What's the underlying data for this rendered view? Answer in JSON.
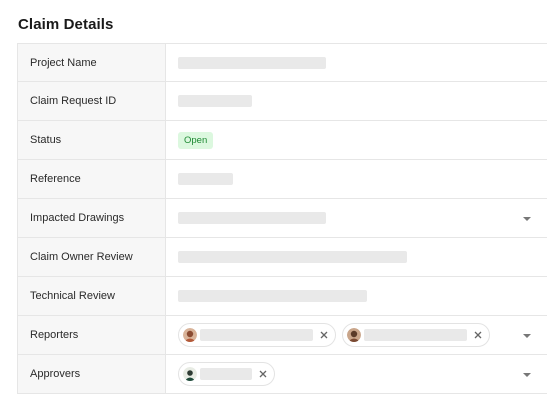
{
  "panel": {
    "title": "Claim Details"
  },
  "rows": [
    {
      "label": "Project Name"
    },
    {
      "label": "Claim Request ID"
    },
    {
      "label": "Status",
      "status": "Open"
    },
    {
      "label": "Reference"
    },
    {
      "label": "Impacted Drawings"
    },
    {
      "label": "Claim Owner Review"
    },
    {
      "label": "Technical Review"
    },
    {
      "label": "Reporters"
    },
    {
      "label": "Approvers"
    }
  ],
  "icons": {
    "dropdown": "chevron-down-icon",
    "remove": "close-icon",
    "avatar": "user-avatar"
  },
  "colors": {
    "status_open_bg": "#dcf8df",
    "status_open_text": "#1f8a34",
    "placeholder": "#e9e9e9"
  }
}
